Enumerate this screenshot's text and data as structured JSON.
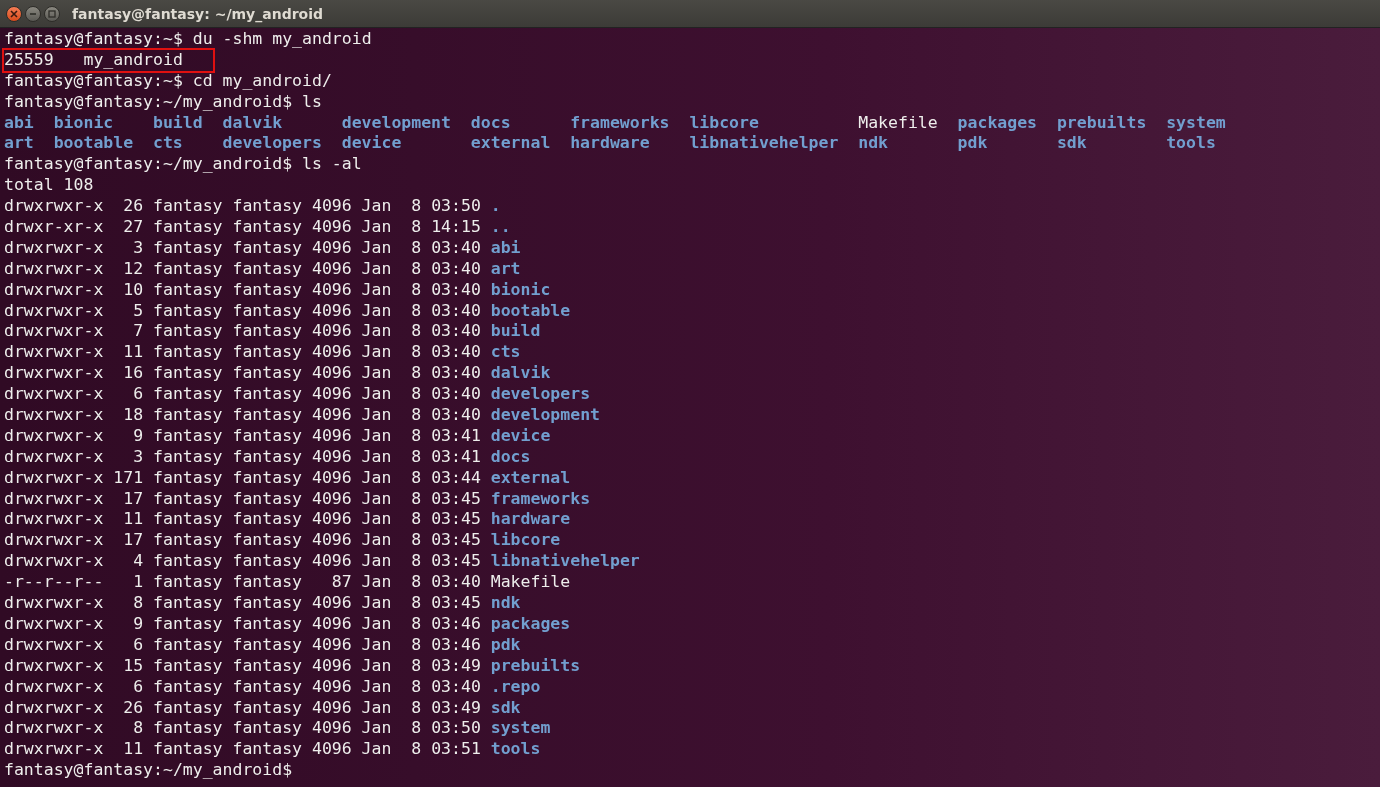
{
  "window": {
    "title": "fantasy@fantasy: ~/my_android"
  },
  "lines": [
    {
      "kind": "prompt",
      "prompt": "fantasy@fantasy:~$",
      "command": "du -shm my_android"
    },
    {
      "kind": "output",
      "text": "25559   my_android",
      "highlighted": true
    },
    {
      "kind": "prompt",
      "prompt": "fantasy@fantasy:~$",
      "command": "cd my_android/"
    },
    {
      "kind": "prompt",
      "prompt": "fantasy@fantasy:~/my_android$",
      "command": "ls"
    },
    {
      "kind": "ls_grid",
      "columns": [
        [
          {
            "name": "abi",
            "kind": "dir"
          },
          {
            "name": "art",
            "kind": "dir"
          }
        ],
        [
          {
            "name": "bionic",
            "kind": "dir"
          },
          {
            "name": "bootable",
            "kind": "dir"
          }
        ],
        [
          {
            "name": "build",
            "kind": "dir"
          },
          {
            "name": "cts",
            "kind": "dir"
          }
        ],
        [
          {
            "name": "dalvik",
            "kind": "dir"
          },
          {
            "name": "developers",
            "kind": "dir"
          }
        ],
        [
          {
            "name": "development",
            "kind": "dir"
          },
          {
            "name": "device",
            "kind": "dir"
          }
        ],
        [
          {
            "name": "docs",
            "kind": "dir"
          },
          {
            "name": "external",
            "kind": "dir"
          }
        ],
        [
          {
            "name": "frameworks",
            "kind": "dir"
          },
          {
            "name": "hardware",
            "kind": "dir"
          }
        ],
        [
          {
            "name": "libcore",
            "kind": "dir"
          },
          {
            "name": "libnativehelper",
            "kind": "dir"
          }
        ],
        [
          {
            "name": "Makefile",
            "kind": "file"
          },
          {
            "name": "ndk",
            "kind": "dir"
          }
        ],
        [
          {
            "name": "packages",
            "kind": "dir"
          },
          {
            "name": "pdk",
            "kind": "dir"
          }
        ],
        [
          {
            "name": "prebuilts",
            "kind": "dir"
          },
          {
            "name": "sdk",
            "kind": "dir"
          }
        ],
        [
          {
            "name": "system",
            "kind": "dir"
          },
          {
            "name": "tools",
            "kind": "dir"
          }
        ]
      ]
    },
    {
      "kind": "prompt",
      "prompt": "fantasy@fantasy:~/my_android$",
      "command": "ls -al"
    },
    {
      "kind": "output",
      "text": "total 108",
      "highlighted": false
    },
    {
      "kind": "listing",
      "entries": [
        {
          "info": "drwxrwxr-x  26 fantasy fantasy 4096 Jan  8 03:50",
          "name": ".",
          "kind": "dir"
        },
        {
          "info": "drwxr-xr-x  27 fantasy fantasy 4096 Jan  8 14:15",
          "name": "..",
          "kind": "dir"
        },
        {
          "info": "drwxrwxr-x   3 fantasy fantasy 4096 Jan  8 03:40",
          "name": "abi",
          "kind": "dir"
        },
        {
          "info": "drwxrwxr-x  12 fantasy fantasy 4096 Jan  8 03:40",
          "name": "art",
          "kind": "dir"
        },
        {
          "info": "drwxrwxr-x  10 fantasy fantasy 4096 Jan  8 03:40",
          "name": "bionic",
          "kind": "dir"
        },
        {
          "info": "drwxrwxr-x   5 fantasy fantasy 4096 Jan  8 03:40",
          "name": "bootable",
          "kind": "dir"
        },
        {
          "info": "drwxrwxr-x   7 fantasy fantasy 4096 Jan  8 03:40",
          "name": "build",
          "kind": "dir"
        },
        {
          "info": "drwxrwxr-x  11 fantasy fantasy 4096 Jan  8 03:40",
          "name": "cts",
          "kind": "dir"
        },
        {
          "info": "drwxrwxr-x  16 fantasy fantasy 4096 Jan  8 03:40",
          "name": "dalvik",
          "kind": "dir"
        },
        {
          "info": "drwxrwxr-x   6 fantasy fantasy 4096 Jan  8 03:40",
          "name": "developers",
          "kind": "dir"
        },
        {
          "info": "drwxrwxr-x  18 fantasy fantasy 4096 Jan  8 03:40",
          "name": "development",
          "kind": "dir"
        },
        {
          "info": "drwxrwxr-x   9 fantasy fantasy 4096 Jan  8 03:41",
          "name": "device",
          "kind": "dir"
        },
        {
          "info": "drwxrwxr-x   3 fantasy fantasy 4096 Jan  8 03:41",
          "name": "docs",
          "kind": "dir"
        },
        {
          "info": "drwxrwxr-x 171 fantasy fantasy 4096 Jan  8 03:44",
          "name": "external",
          "kind": "dir"
        },
        {
          "info": "drwxrwxr-x  17 fantasy fantasy 4096 Jan  8 03:45",
          "name": "frameworks",
          "kind": "dir"
        },
        {
          "info": "drwxrwxr-x  11 fantasy fantasy 4096 Jan  8 03:45",
          "name": "hardware",
          "kind": "dir"
        },
        {
          "info": "drwxrwxr-x  17 fantasy fantasy 4096 Jan  8 03:45",
          "name": "libcore",
          "kind": "dir"
        },
        {
          "info": "drwxrwxr-x   4 fantasy fantasy 4096 Jan  8 03:45",
          "name": "libnativehelper",
          "kind": "dir"
        },
        {
          "info": "-r--r--r--   1 fantasy fantasy   87 Jan  8 03:40",
          "name": "Makefile",
          "kind": "file"
        },
        {
          "info": "drwxrwxr-x   8 fantasy fantasy 4096 Jan  8 03:45",
          "name": "ndk",
          "kind": "dir"
        },
        {
          "info": "drwxrwxr-x   9 fantasy fantasy 4096 Jan  8 03:46",
          "name": "packages",
          "kind": "dir"
        },
        {
          "info": "drwxrwxr-x   6 fantasy fantasy 4096 Jan  8 03:46",
          "name": "pdk",
          "kind": "dir"
        },
        {
          "info": "drwxrwxr-x  15 fantasy fantasy 4096 Jan  8 03:49",
          "name": "prebuilts",
          "kind": "dir"
        },
        {
          "info": "drwxrwxr-x   6 fantasy fantasy 4096 Jan  8 03:40",
          "name": ".repo",
          "kind": "dir"
        },
        {
          "info": "drwxrwxr-x  26 fantasy fantasy 4096 Jan  8 03:49",
          "name": "sdk",
          "kind": "dir"
        },
        {
          "info": "drwxrwxr-x   8 fantasy fantasy 4096 Jan  8 03:50",
          "name": "system",
          "kind": "dir"
        },
        {
          "info": "drwxrwxr-x  11 fantasy fantasy 4096 Jan  8 03:51",
          "name": "tools",
          "kind": "dir"
        }
      ]
    },
    {
      "kind": "prompt",
      "prompt": "fantasy@fantasy:~/my_android$"
    }
  ]
}
